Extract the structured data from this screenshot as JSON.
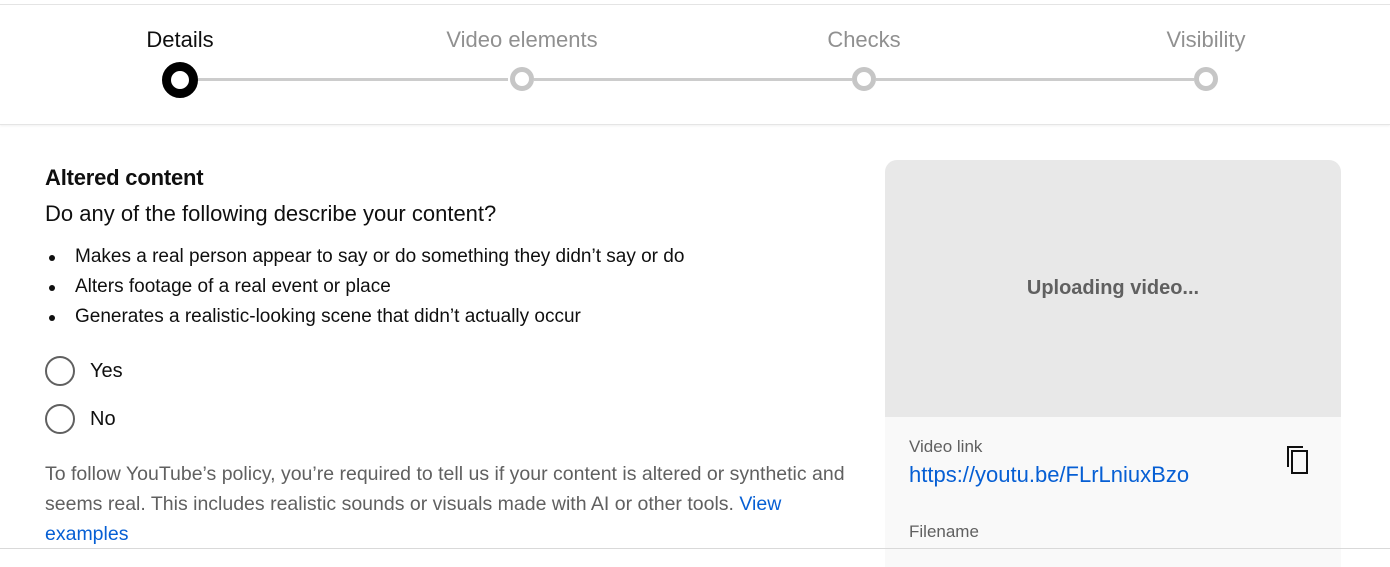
{
  "stepper": {
    "steps": [
      {
        "label": "Details",
        "active": true
      },
      {
        "label": "Video elements",
        "active": false
      },
      {
        "label": "Checks",
        "active": false
      },
      {
        "label": "Visibility",
        "active": false
      }
    ]
  },
  "altered_content": {
    "title": "Altered content",
    "question": "Do any of the following describe your content?",
    "bullets": [
      "Makes a real person appear to say or do something they didn’t say or do",
      "Alters footage of a real event or place",
      "Generates a realistic-looking scene that didn’t actually occur"
    ],
    "options": [
      {
        "label": "Yes",
        "selected": false
      },
      {
        "label": "No",
        "selected": false
      }
    ],
    "policy_text": "To follow YouTube’s policy, you’re required to tell us if your content is altered or synthetic and seems real. This includes realistic sounds or visuals made with AI or other tools.",
    "policy_link": "View examples"
  },
  "preview": {
    "status": "Uploading video...",
    "video_link_label": "Video link",
    "video_link": "https://youtu.be/FLrLniuxBzo",
    "copy_icon": "copy-icon",
    "filename_label": "Filename"
  },
  "colors": {
    "accent_link": "#065fd4",
    "active_step": "#000000",
    "inactive_step": "#c6c6c6"
  }
}
